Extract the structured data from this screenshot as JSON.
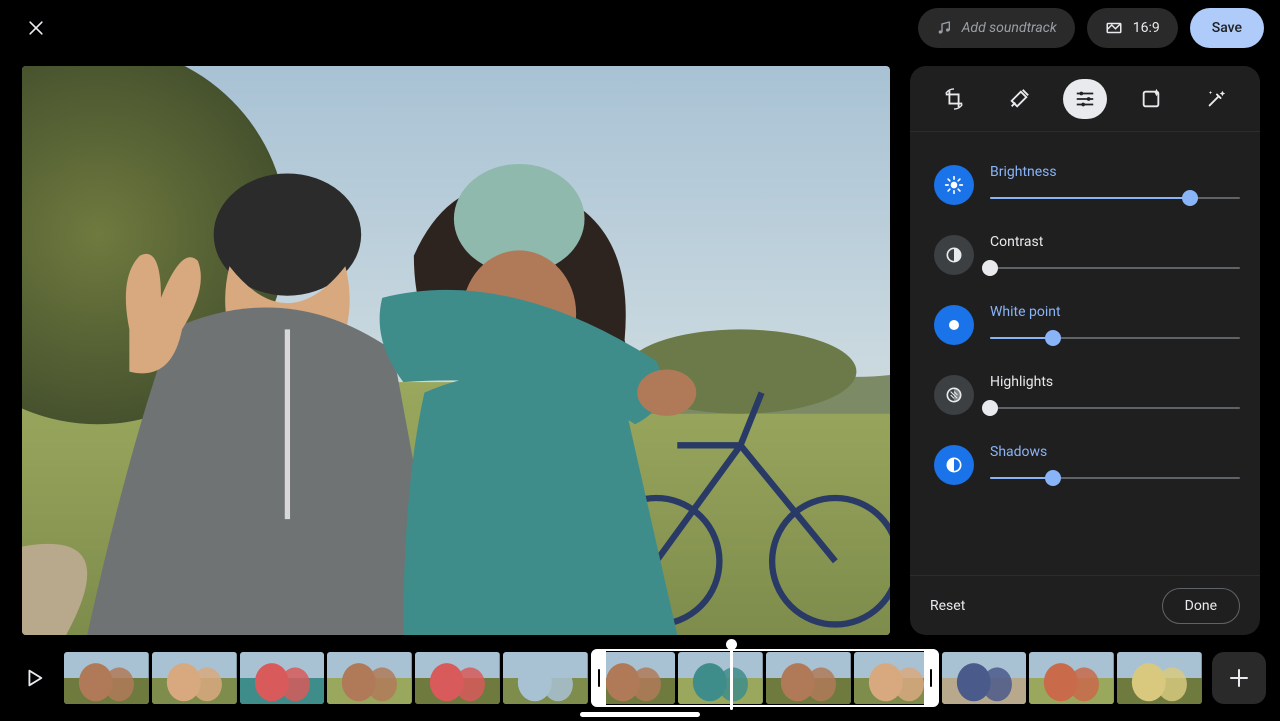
{
  "topbar": {
    "soundtrack_label": "Add soundtrack",
    "aspect_label": "16:9",
    "save_label": "Save"
  },
  "panel": {
    "tabs": [
      "crop",
      "tools",
      "adjust",
      "filters",
      "magic"
    ],
    "active_tab": 2,
    "reset_label": "Reset",
    "done_label": "Done"
  },
  "adjustments": [
    {
      "key": "brightness",
      "label": "Brightness",
      "value": 80,
      "active": true
    },
    {
      "key": "contrast",
      "label": "Contrast",
      "value": 0,
      "active": false
    },
    {
      "key": "white_point",
      "label": "White point",
      "value": 25,
      "active": true
    },
    {
      "key": "highlights",
      "label": "Highlights",
      "value": 0,
      "active": false
    },
    {
      "key": "shadows",
      "label": "Shadows",
      "value": 25,
      "active": true
    }
  ],
  "timeline": {
    "clip_count": 13,
    "selection_start_index": 6,
    "selection_end_index": 9,
    "playhead_fraction": 0.585
  }
}
